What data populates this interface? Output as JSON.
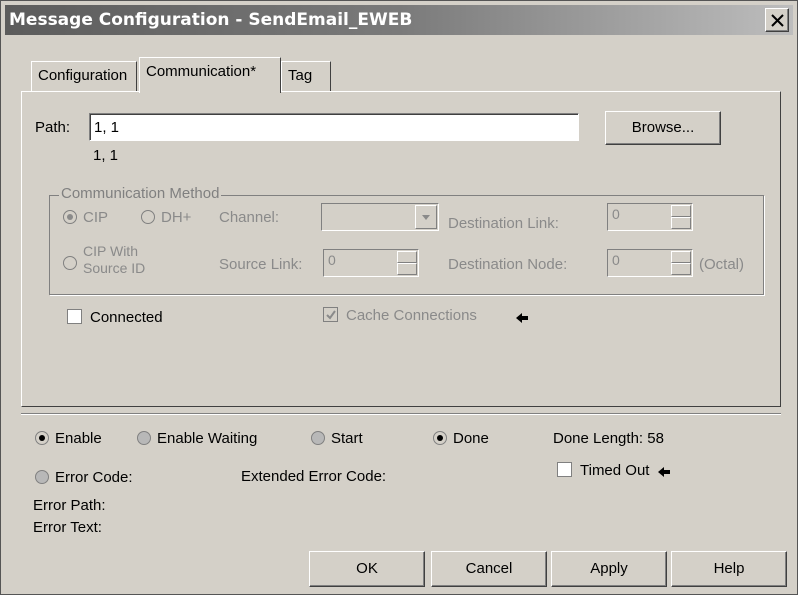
{
  "window": {
    "title": "Message Configuration - SendEmail_EWEB"
  },
  "tabs": [
    {
      "label": "Configuration"
    },
    {
      "label": "Communication*"
    },
    {
      "label": "Tag"
    }
  ],
  "communication": {
    "path_label": "Path:",
    "path_value": "1, 1",
    "path_resolved": "1, 1",
    "browse_label": "Browse...",
    "method": {
      "title": "Communication Method",
      "cip_label": "CIP",
      "dhplus_label": "DH+",
      "channel_label": "Channel:",
      "dest_link_label": "Destination Link:",
      "dest_link_value": "0",
      "cip_source_label_1": "CIP With",
      "cip_source_label_2": "Source ID",
      "source_link_label": "Source Link:",
      "source_link_value": "0",
      "dest_node_label": "Destination Node:",
      "dest_node_value": "0",
      "octal_label": "(Octal)"
    },
    "connected_label": "Connected",
    "cache_label": "Cache Connections"
  },
  "status": {
    "enable_label": "Enable",
    "enable_waiting_label": "Enable Waiting",
    "start_label": "Start",
    "done_label": "Done",
    "done_length_label": "Done Length: 58",
    "error_code_label": "Error Code:",
    "extended_error_label": "Extended Error Code:",
    "timed_out_label": "Timed Out",
    "error_path_label": "Error Path:",
    "error_text_label": "Error Text:"
  },
  "buttons": {
    "ok": "OK",
    "cancel": "Cancel",
    "apply": "Apply",
    "help": "Help"
  }
}
